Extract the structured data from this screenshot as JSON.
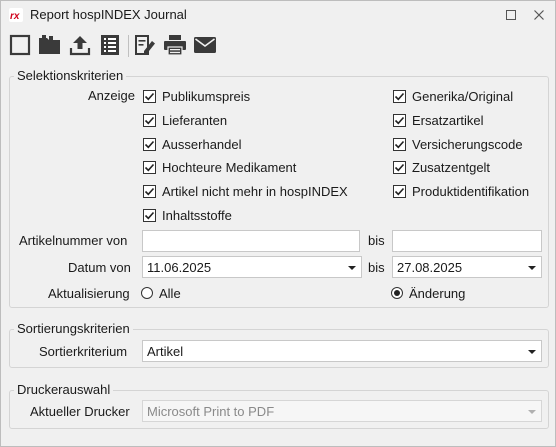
{
  "window": {
    "title": "Report hospINDEX Journal",
    "app_icon_text": "rx"
  },
  "toolbar": {
    "buttons": [
      {
        "name": "new",
        "icon": "blank-square-icon"
      },
      {
        "name": "open",
        "icon": "folder-icon"
      },
      {
        "name": "export",
        "icon": "upload-icon"
      },
      {
        "name": "list",
        "icon": "list-icon"
      },
      {
        "name": "edit",
        "icon": "edit-document-icon"
      },
      {
        "name": "print",
        "icon": "printer-icon"
      },
      {
        "name": "email",
        "icon": "envelope-icon"
      }
    ]
  },
  "selection": {
    "title": "Selektionskriterien",
    "anzeige_label": "Anzeige",
    "left_checks": [
      {
        "label": "Publikumspreis",
        "checked": true
      },
      {
        "label": "Lieferanten",
        "checked": true
      },
      {
        "label": "Ausserhandel",
        "checked": true
      },
      {
        "label": "Hochteure Medikament",
        "checked": true
      },
      {
        "label": "Artikel nicht mehr in hospINDEX",
        "checked": true
      },
      {
        "label": "Inhaltsstoffe",
        "checked": true
      }
    ],
    "right_checks": [
      {
        "label": "Generika/Original",
        "checked": true
      },
      {
        "label": "Ersatzartikel",
        "checked": true
      },
      {
        "label": "Versicherungscode",
        "checked": true
      },
      {
        "label": "Zusatzentgelt",
        "checked": true
      },
      {
        "label": "Produktidentifikation",
        "checked": true
      }
    ],
    "artikelnummer_label": "Artikelnummer von",
    "artikelnummer_from": "",
    "bis_label": "bis",
    "artikelnummer_to": "",
    "datum_label": "Datum von",
    "datum_from": "11.06.2025",
    "datum_to": "27.08.2025",
    "aktualisierung_label": "Aktualisierung",
    "radio_alle": {
      "label": "Alle",
      "selected": false
    },
    "radio_aenderung": {
      "label": "Änderung",
      "selected": true
    }
  },
  "sorting": {
    "title": "Sortierungskriterien",
    "label": "Sortierkriterium",
    "value": "Artikel"
  },
  "printer": {
    "title": "Druckerauswahl",
    "label": "Aktueller Drucker",
    "value": "Microsoft Print to PDF"
  }
}
